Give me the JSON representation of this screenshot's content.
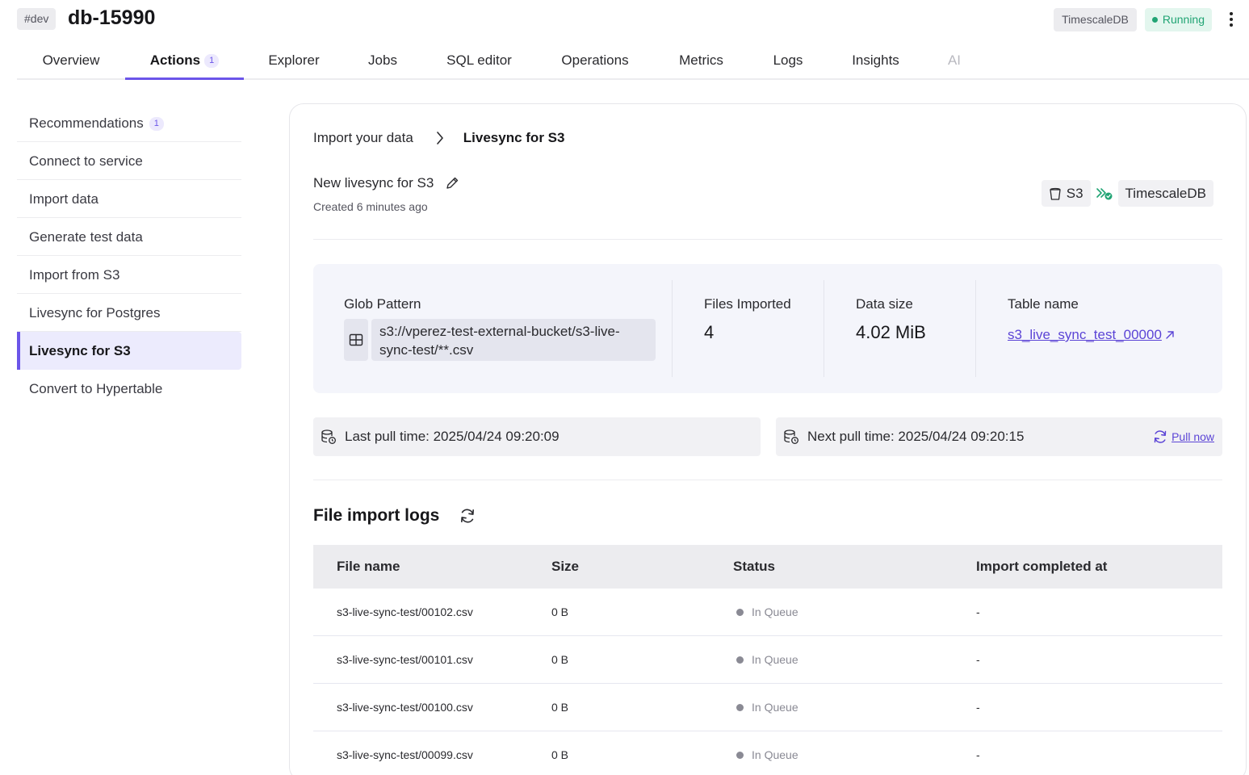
{
  "header": {
    "env_tag": "#dev",
    "service_name": "db-15990",
    "engine_badge": "TimescaleDB",
    "status_label": "Running",
    "status_color": "#21a474",
    "more_icon": "kebab-icon"
  },
  "tabs": [
    {
      "label": "Overview"
    },
    {
      "label": "Actions",
      "count": "1",
      "active": true
    },
    {
      "label": "Explorer"
    },
    {
      "label": "Jobs"
    },
    {
      "label": "SQL editor"
    },
    {
      "label": "Operations"
    },
    {
      "label": "Metrics"
    },
    {
      "label": "Logs"
    },
    {
      "label": "Insights"
    },
    {
      "label": "AI",
      "disabled": true
    }
  ],
  "sidebar": {
    "items": [
      {
        "label": "Recommendations",
        "count": "1"
      },
      {
        "label": "Connect to service"
      },
      {
        "label": "Import data"
      },
      {
        "label": "Generate test data"
      },
      {
        "label": "Import from S3"
      },
      {
        "label": "Livesync for Postgres"
      },
      {
        "label": "Livesync for S3",
        "active": true
      },
      {
        "label": "Convert to Hypertable"
      }
    ]
  },
  "breadcrumb": {
    "parent": "Import your data",
    "current": "Livesync for S3"
  },
  "livesync": {
    "name": "New livesync for S3",
    "created": "Created 6 minutes ago",
    "source": "S3",
    "target": "TimescaleDB"
  },
  "stats": {
    "glob_label": "Glob Pattern",
    "glob_value": "s3://vperez-test-external-bucket/s3-live-sync-test/**.csv",
    "files_label": "Files Imported",
    "files_value": "4",
    "size_label": "Data size",
    "size_value": "4.02 MiB",
    "table_label": "Table name",
    "table_value": "s3_live_sync_test_00000"
  },
  "pull": {
    "last": "Last pull time: 2025/04/24 09:20:09",
    "next": "Next pull time: 2025/04/24 09:20:15",
    "pull_now": "Pull now"
  },
  "logs": {
    "title": "File import logs",
    "columns": [
      "File name",
      "Size",
      "Status",
      "Import completed at"
    ],
    "rows": [
      {
        "file": "s3-live-sync-test/00102.csv",
        "size": "0 B",
        "status": "In Queue",
        "completed": "-"
      },
      {
        "file": "s3-live-sync-test/00101.csv",
        "size": "0 B",
        "status": "In Queue",
        "completed": "-"
      },
      {
        "file": "s3-live-sync-test/00100.csv",
        "size": "0 B",
        "status": "In Queue",
        "completed": "-"
      },
      {
        "file": "s3-live-sync-test/00099.csv",
        "size": "0 B",
        "status": "In Queue",
        "completed": "-"
      }
    ]
  },
  "colors": {
    "accent": "#6b55e9",
    "link": "#5b44d6",
    "running": "#21a474"
  }
}
